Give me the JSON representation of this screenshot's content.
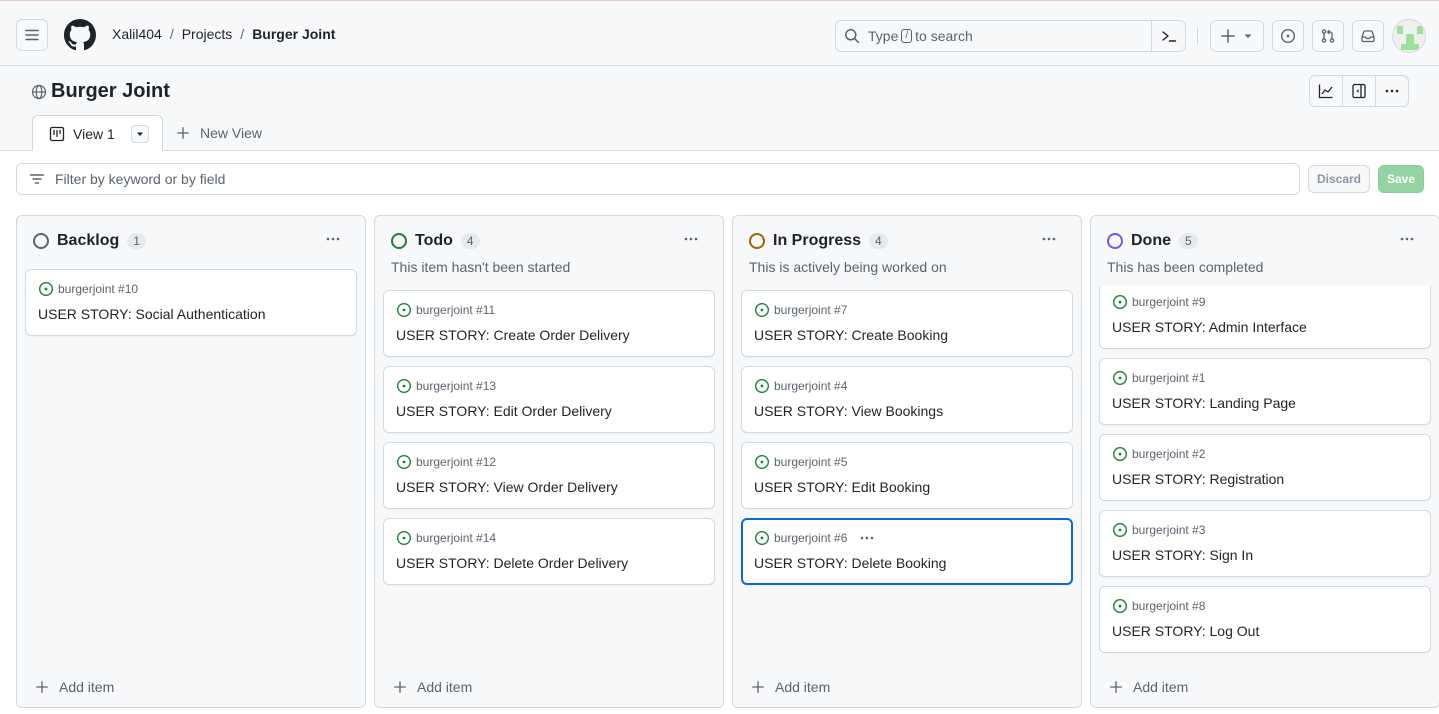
{
  "header": {
    "breadcrumb": [
      "Xalil404",
      "Projects",
      "Burger Joint"
    ],
    "search": {
      "prefix": "Type",
      "key": "/",
      "suffix": "to search"
    },
    "icons": [
      "hamburger-menu-icon",
      "github-logo",
      "search-icon",
      "command-palette-icon",
      "plus-icon",
      "issues-icon",
      "pull-request-icon",
      "inbox-icon",
      "avatar"
    ]
  },
  "project": {
    "title": "Burger Joint",
    "visibility_icon": "globe-icon",
    "toolbar": [
      "insights-icon",
      "side-panel-icon",
      "more-options-icon"
    ]
  },
  "views": {
    "tabs": [
      {
        "label": "View 1",
        "icon": "board-icon",
        "active": true
      }
    ],
    "new_view_label": "New View"
  },
  "filter": {
    "placeholder": "Filter by keyword or by field",
    "discard_label": "Discard",
    "save_label": "Save"
  },
  "board": {
    "add_item_label": "Add item",
    "columns": [
      {
        "name": "Backlog",
        "count": "1",
        "description": "",
        "status_color": "#59636e",
        "cards": [
          {
            "ref": "burgerjoint #10",
            "title": "USER STORY: Social Authentication"
          }
        ]
      },
      {
        "name": "Todo",
        "count": "4",
        "description": "This item hasn't been started",
        "status_color": "#1a7f37",
        "cards": [
          {
            "ref": "burgerjoint #11",
            "title": "USER STORY: Create Order Delivery"
          },
          {
            "ref": "burgerjoint #13",
            "title": "USER STORY: Edit Order Delivery"
          },
          {
            "ref": "burgerjoint #12",
            "title": "USER STORY: View Order Delivery"
          },
          {
            "ref": "burgerjoint #14",
            "title": "USER STORY: Delete Order Delivery"
          }
        ]
      },
      {
        "name": "In Progress",
        "count": "4",
        "description": "This is actively being worked on",
        "status_color": "#9a6700",
        "cards": [
          {
            "ref": "burgerjoint #7",
            "title": "USER STORY: Create Booking"
          },
          {
            "ref": "burgerjoint #4",
            "title": "USER STORY: View Bookings"
          },
          {
            "ref": "burgerjoint #5",
            "title": "USER STORY: Edit Booking"
          },
          {
            "ref": "burgerjoint #6",
            "title": "USER STORY: Delete Booking",
            "selected": true
          }
        ]
      },
      {
        "name": "Done",
        "count": "5",
        "description": "This has been completed",
        "status_color": "#8250df",
        "cards": [
          {
            "ref": "burgerjoint #9",
            "title": "USER STORY: Admin Interface"
          },
          {
            "ref": "burgerjoint #1",
            "title": "USER STORY: Landing Page"
          },
          {
            "ref": "burgerjoint #2",
            "title": "USER STORY: Registration"
          },
          {
            "ref": "burgerjoint #3",
            "title": "USER STORY: Sign In"
          },
          {
            "ref": "burgerjoint #8",
            "title": "USER STORY: Log Out"
          }
        ]
      }
    ]
  },
  "colors": {
    "open_issue": "#1a7f37",
    "selected_border": "#0969da",
    "save_button": "#94d3a2"
  }
}
